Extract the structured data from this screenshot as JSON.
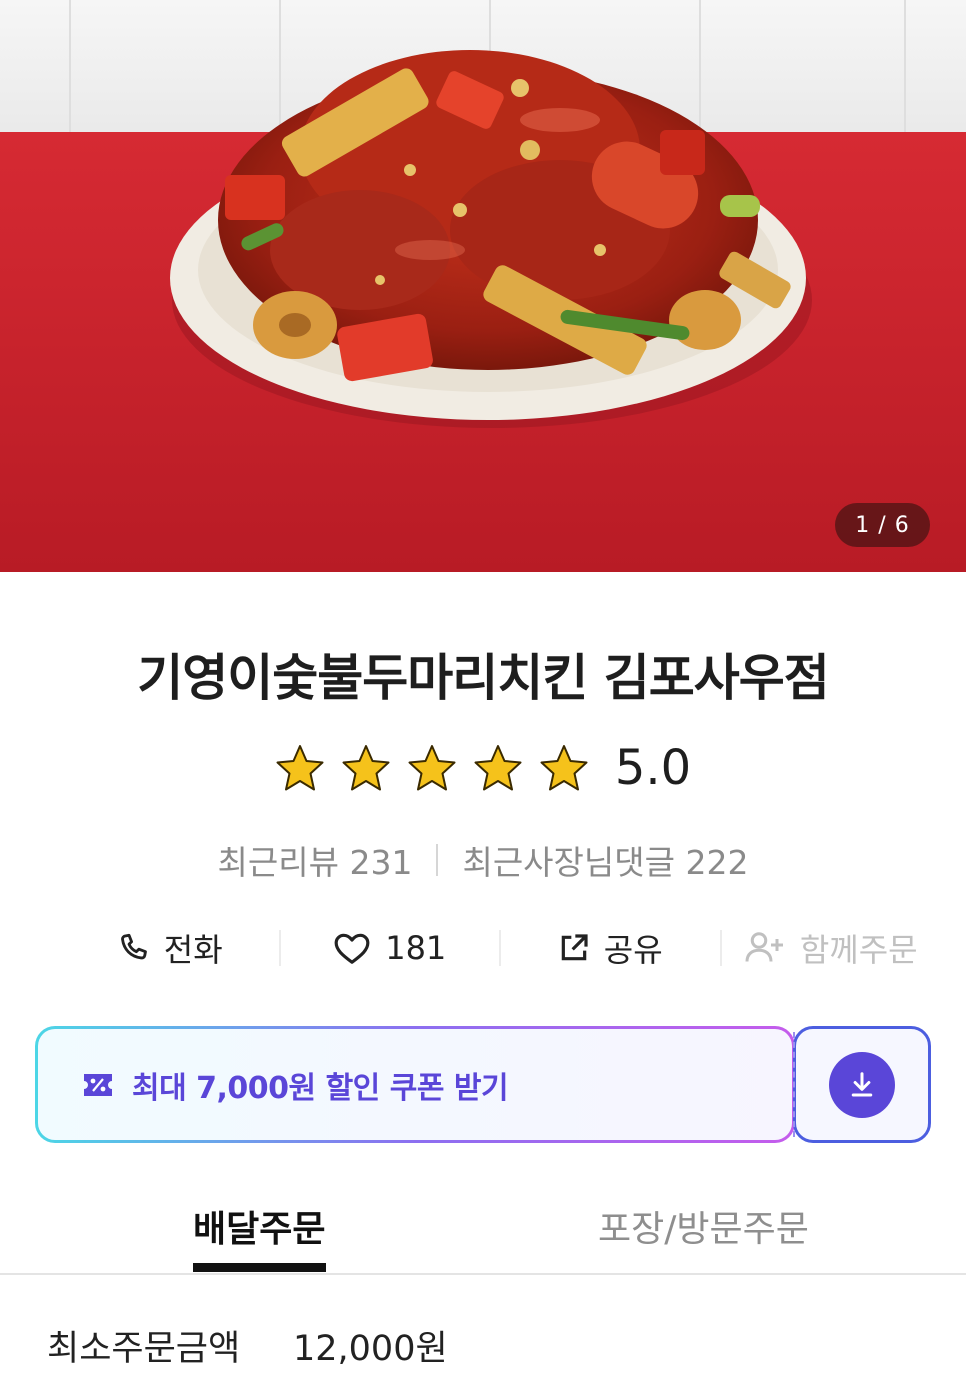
{
  "hero": {
    "image_counter": "1 / 6",
    "image_subject": "양념치킨 접시"
  },
  "store": {
    "name": "기영이숯불두마리치킨 김포사우점",
    "rating": "5.0",
    "star_count": 5,
    "recent_reviews": "최근리뷰 231",
    "owner_replies": "최근사장님댓글 222"
  },
  "actions": {
    "call_label": "전화",
    "like_count": "181",
    "share_label": "공유",
    "group_order_label": "함께주문"
  },
  "coupon": {
    "text": "최대 7,000원 할인 쿠폰 받기"
  },
  "tabs": {
    "delivery": "배달주문",
    "pickup": "포장/방문주문"
  },
  "order_info": {
    "min_order_label": "최소주문금액",
    "min_order_value": "12,000원"
  },
  "colors": {
    "accent_purple": "#5a46d8",
    "star_gold": "#f5c21b",
    "hero_red": "#c8212b"
  }
}
